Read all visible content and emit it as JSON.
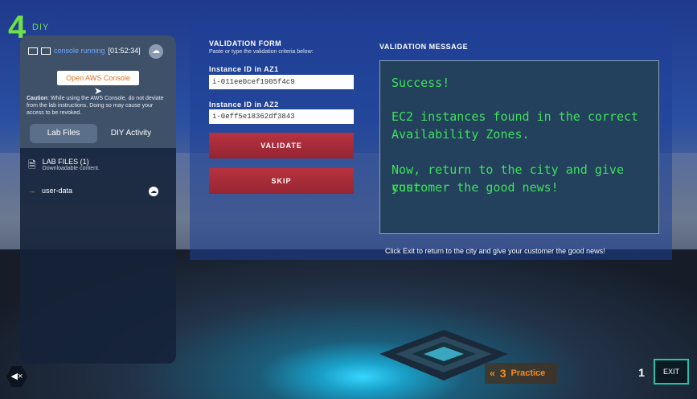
{
  "badge": {
    "number": "4",
    "label": "DIY"
  },
  "sidebar": {
    "status_text": "console running",
    "timer": "[01:52:34]",
    "console_button": "Open AWS Console",
    "caution_label": "Caution",
    "caution_text": ": While using the AWS Console, do not deviate from the lab instructions. Doing so may cause your access to be revoked.",
    "tabs": [
      {
        "label": "Lab Files",
        "active": true
      },
      {
        "label": "DIY Activity",
        "active": false
      }
    ],
    "files_title": "LAB FILES (1)",
    "files_subtitle": "Downloadable content.",
    "files": [
      {
        "name": "user-data"
      }
    ]
  },
  "form": {
    "title": "VALIDATION FORM",
    "subtitle": "Paste or type the validation criteria below:",
    "field1_label": "Instance ID in AZ1",
    "field1_value": "i-011ee0cef1905f4c9",
    "field2_label": "Instance ID in AZ2",
    "field2_value": "i-0eff5e18362df3843",
    "validate_button": "VALIDATE",
    "skip_button": "SKIP"
  },
  "message": {
    "title": "VALIDATION MESSAGE",
    "line1": "Success!",
    "line2": "EC2 instances found in the correct",
    "line3": "Availability Zones.",
    "line4": "Now, return to the city and give your",
    "line5": "customer the good news!",
    "note": "Click Exit to return to the city and give your customer the good news!"
  },
  "footer": {
    "practice_number": "3",
    "practice_label": "Practice",
    "exit_label": "EXIT"
  },
  "colors": {
    "accent_green": "#3ee15a",
    "accent_orange": "#f08a24",
    "button_red": "#b8323f",
    "exit_border": "#28c2a8"
  },
  "icons": [
    "cloud-upload-icon",
    "cursor-icon",
    "file-icon",
    "arrow-right-icon",
    "download-icon",
    "mute-icon",
    "chevron-left-icon",
    "level-one-icon"
  ]
}
